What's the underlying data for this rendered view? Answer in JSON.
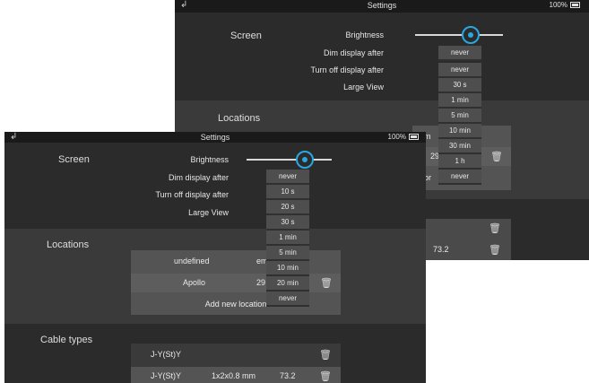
{
  "back": {
    "title": "Settings",
    "battery": "100%",
    "screen_label": "Screen",
    "brightness_label": "Brightness",
    "dim_label": "Dim display after",
    "turnoff_label": "Turn off display after",
    "largeview_label": "Large View",
    "locations_label": "Locations",
    "dim_value": "never",
    "turnoff_value": "never",
    "dropdown_options": [
      "30 s",
      "1 min",
      "5 min",
      "10 min",
      "30 min",
      "1 h",
      "never"
    ],
    "loc_row1_suffix": "m",
    "loc_row2_value": "29",
    "loc_row3_suffix": "or",
    "cable_value": "73.2"
  },
  "front": {
    "title": "Settings",
    "battery": "100%",
    "screen_label": "Screen",
    "brightness_label": "Brightness",
    "dim_label": "Dim display after",
    "turnoff_label": "Turn off display after",
    "largeview_label": "Large View",
    "locations_label": "Locations",
    "cable_types_label": "Cable types",
    "dim_value": "never",
    "dropdown_options": [
      "10 s",
      "20 s",
      "30 s",
      "1 min",
      "5 min",
      "10 min",
      "20 min",
      "never"
    ],
    "locations": [
      {
        "name": "undefined",
        "value": "em"
      },
      {
        "name": "Apollo",
        "value": "29"
      }
    ],
    "add_location": "Add new location",
    "cables": [
      {
        "name": "J-Y(St)Y",
        "spec": "",
        "value": ""
      },
      {
        "name": "J-Y(St)Y",
        "spec": "1x2x0.8 mm",
        "value": "73.2"
      }
    ]
  }
}
